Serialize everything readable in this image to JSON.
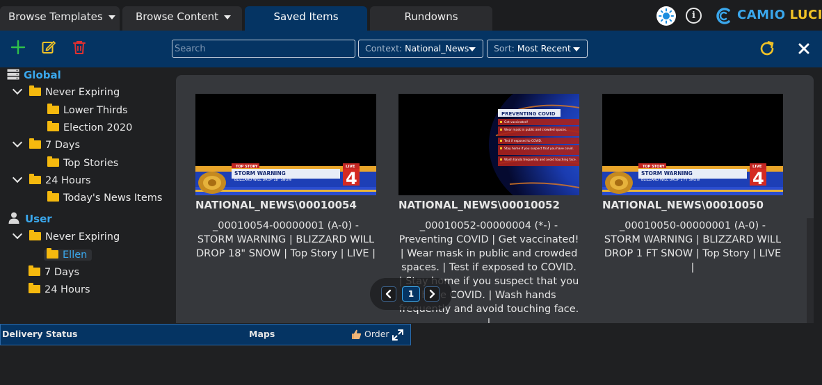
{
  "tabs": [
    {
      "label": "Browse Templates",
      "has_caret": true,
      "active": false
    },
    {
      "label": "Browse Content",
      "has_caret": true,
      "active": false
    },
    {
      "label": "Saved Items",
      "has_caret": false,
      "active": true
    },
    {
      "label": "Rundowns",
      "has_caret": false,
      "active": false
    }
  ],
  "header": {
    "theme_icon": "sun-icon",
    "info_icon": "info-icon",
    "info_glyph": "i",
    "brand_primary": "CAMIO",
    "brand_secondary": "LUCI",
    "brand_colors": {
      "primary": "#3aa7ec",
      "secondary": "#f2c326"
    }
  },
  "toolbar": {
    "add_icon": "plus-icon",
    "edit_icon": "edit-icon",
    "delete_icon": "trash-icon",
    "search_placeholder": "Search",
    "search_value": "",
    "context_label": "Context:",
    "context_value": "National_News",
    "sort_label": "Sort:",
    "sort_value": "Most Recent",
    "refresh_icon": "refresh-icon",
    "close_icon": "close-icon"
  },
  "sidebar": {
    "global_label": "Global",
    "global_icon": "server-icon",
    "global_items": {
      "never_expiring": "Never Expiring",
      "lower_thirds": "Lower Thirds",
      "election_2020": "Election 2020",
      "seven_days": "7 Days",
      "top_stories": "Top Stories",
      "twentyfour_hours": "24 Hours",
      "todays_news": "Today's News Items"
    },
    "user_label": "User",
    "user_icon": "user-icon",
    "user_items": {
      "never_expiring": "Never Expiring",
      "ellen": "Ellen",
      "seven_days": "7 Days",
      "twentyfour_hours": "24 Hours"
    }
  },
  "cards": [
    {
      "title": "NATIONAL_NEWS\\00010054",
      "description": "_00010054-00000001 (A-0) - STORM WARNING | BLIZZARD WILL DROP 18\" SNOW | Top Story | LIVE |",
      "thumb": {
        "tag": "TOP STORY",
        "headline": "STORM WARNING",
        "sub": "BLIZZARD WILL DROP 18\" SNOW",
        "live": "LIVE",
        "channel": "4"
      }
    },
    {
      "title": "NATIONAL_NEWS\\00010052",
      "description": "_00010052-00000004 (*-) - Preventing COVID | Get vaccinated! | Wear mask in public and crowded spaces. | Test if exposed to COVID. | Stay home if you suspect that you have COVID. | Wash hands frequently and avoid touching face. |",
      "thumb": {
        "headline": "PREVENTING COVID",
        "bullets": [
          "Get vaccinated!",
          "Wear mask in public and crowded spaces.",
          "Test if exposed to COVID.",
          "Stay home if you suspect that you have covid.",
          "Wash hands frequently and avoid touching face."
        ]
      }
    },
    {
      "title": "NATIONAL_NEWS\\00010050",
      "description": "_00010050-00000001 (A-0) - STORM WARNING | BLIZZARD WILL DROP 1 FT SNOW | Top Story | LIVE |",
      "thumb": {
        "tag": "TOP STORY",
        "headline": "STORM WARNING",
        "sub": "BLIZZARD WILL DROP 1 FT SNOW",
        "live": "LIVE",
        "channel": "4"
      }
    }
  ],
  "pagination": {
    "current_page": "1",
    "prev_icon": "chevron-left-icon",
    "next_icon": "chevron-right-icon"
  },
  "bottom_bar": {
    "delivery_status": "Delivery Status",
    "maps": "Maps",
    "order": "Order",
    "order_icon": "thumbs-up-icon",
    "expand_icon": "expand-icon"
  }
}
